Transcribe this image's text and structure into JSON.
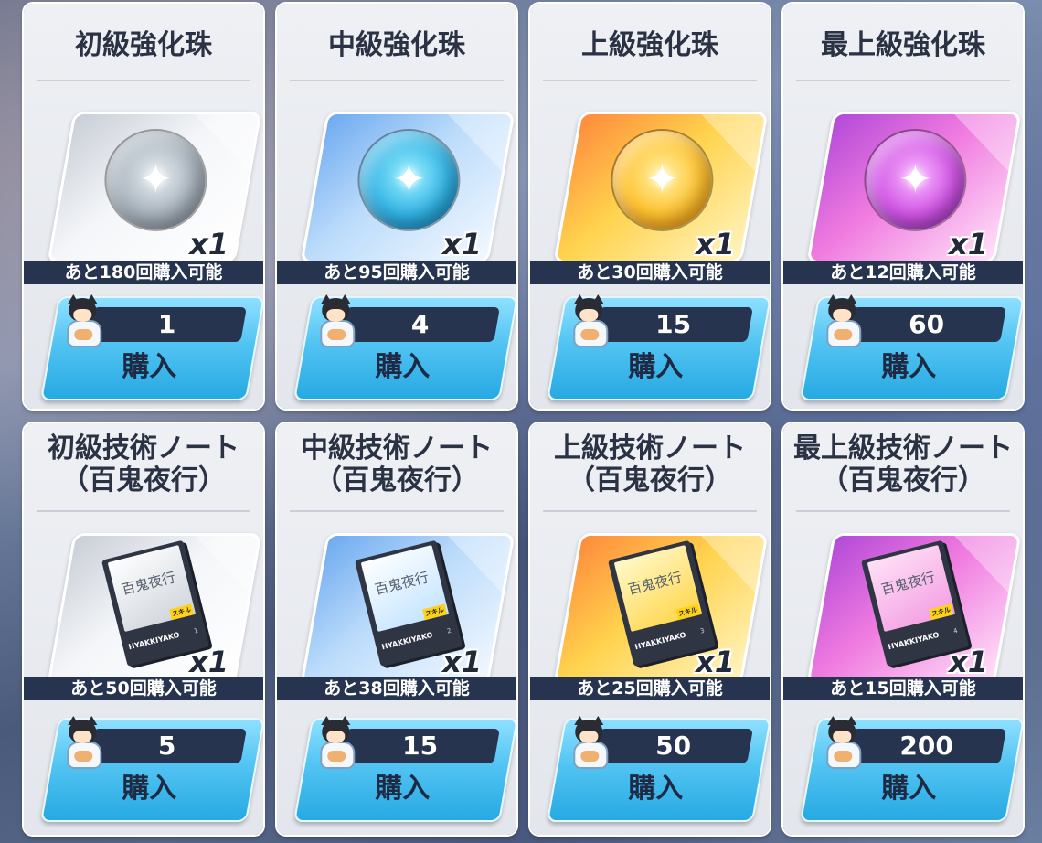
{
  "shop": {
    "items": [
      {
        "title": "初級強化珠",
        "type": "orb",
        "icon": "orb-icon",
        "quantity": "x1",
        "remaining": "あと180回購入可能",
        "price": "1",
        "buy_label": "購入"
      },
      {
        "title": "中級強化珠",
        "type": "orb",
        "icon": "orb-icon",
        "quantity": "x1",
        "remaining": "あと95回購入可能",
        "price": "4",
        "buy_label": "購入"
      },
      {
        "title": "上級強化珠",
        "type": "orb",
        "icon": "orb-icon",
        "quantity": "x1",
        "remaining": "あと30回購入可能",
        "price": "15",
        "buy_label": "購入"
      },
      {
        "title": "最上級強化珠",
        "type": "orb",
        "icon": "orb-icon",
        "quantity": "x1",
        "remaining": "あと12回購入可能",
        "price": "60",
        "buy_label": "購入"
      },
      {
        "title": "初級技術ノート",
        "subtitle": "（百鬼夜行）",
        "type": "book",
        "icon": "skill-note-icon",
        "book_text": "百鬼夜行",
        "book_tag": "スキル",
        "book_brand": "HYAKKIYAKO",
        "book_number": "1",
        "quantity": "x1",
        "remaining": "あと50回購入可能",
        "price": "5",
        "buy_label": "購入"
      },
      {
        "title": "中級技術ノート",
        "subtitle": "（百鬼夜行）",
        "type": "book",
        "icon": "skill-note-icon",
        "book_text": "百鬼夜行",
        "book_tag": "スキル",
        "book_brand": "HYAKKIYAKO",
        "book_number": "2",
        "quantity": "x1",
        "remaining": "あと38回購入可能",
        "price": "15",
        "buy_label": "購入"
      },
      {
        "title": "上級技術ノート",
        "subtitle": "（百鬼夜行）",
        "type": "book",
        "icon": "skill-note-icon",
        "book_text": "百鬼夜行",
        "book_tag": "スキル",
        "book_brand": "HYAKKIYAKO",
        "book_number": "3",
        "quantity": "x1",
        "remaining": "あと25回購入可能",
        "price": "50",
        "buy_label": "購入"
      },
      {
        "title": "最上級技術ノート",
        "subtitle": "（百鬼夜行）",
        "type": "book",
        "icon": "skill-note-icon",
        "book_text": "百鬼夜行",
        "book_tag": "スキル",
        "book_brand": "HYAKKIYAKO",
        "book_number": "4",
        "quantity": "x1",
        "remaining": "あと15回購入可能",
        "price": "200",
        "buy_label": "購入"
      }
    ],
    "currency_icon": "character-token-icon",
    "tier_colors": [
      "#a9b4be",
      "#31b4e6",
      "#ffc22e",
      "#d255e6"
    ],
    "accent_color": "#273450",
    "button_color": "#52c4f2"
  }
}
